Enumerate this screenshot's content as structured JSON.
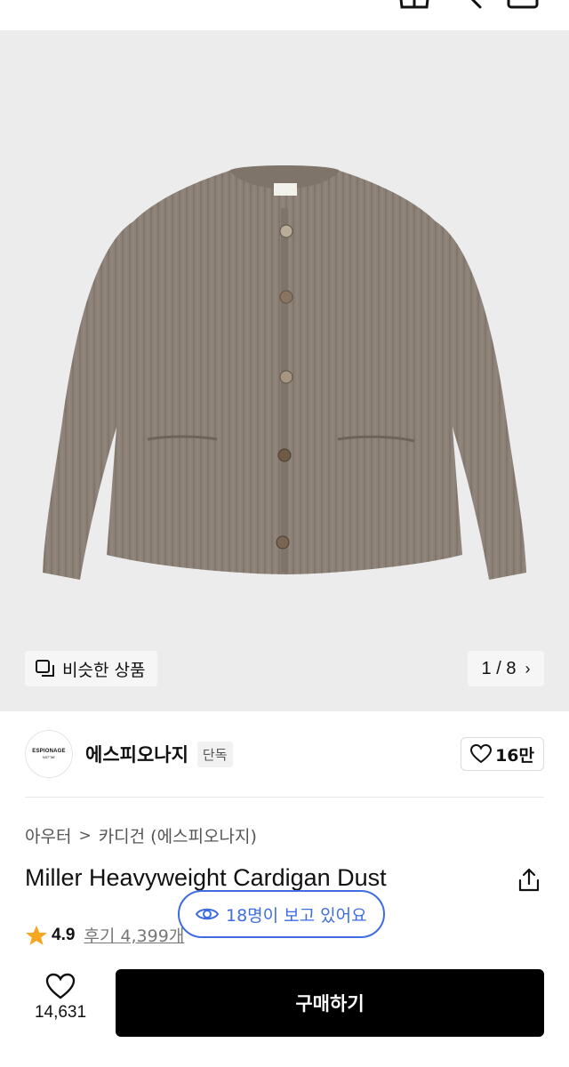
{
  "top_bar": {
    "icons": [
      "cart-icon",
      "search-icon",
      "menu-icon"
    ]
  },
  "hero": {
    "image_alt": "cardigan product photo",
    "similar_label": "비슷한 상품",
    "page_indicator": "1 / 8",
    "current_page": 1,
    "total_pages": 8
  },
  "brand": {
    "logo_text": "ESPIONAGE",
    "logo_subtext": "N37°56'",
    "name": "에스피오나지",
    "badge": "단독",
    "likes": "16만"
  },
  "breadcrumb": {
    "category": "아우터",
    "subcategory": "카디건 (에스피오나지)"
  },
  "product": {
    "title": "Miller Heavyweight Cardigan Dust"
  },
  "rating": {
    "score": "4.9",
    "reviews": "후기 4,399개"
  },
  "viewers": {
    "text": "18명이 보고 있어요"
  },
  "bottom_bar": {
    "wish_count": "14,631",
    "buy_label": "구매하기"
  },
  "colors": {
    "accent_blue": "#3d6de0",
    "star": "#f5a623",
    "buy_button": "#000000",
    "hero_bg": "#ececed",
    "cardigan": "#8a7f74"
  }
}
